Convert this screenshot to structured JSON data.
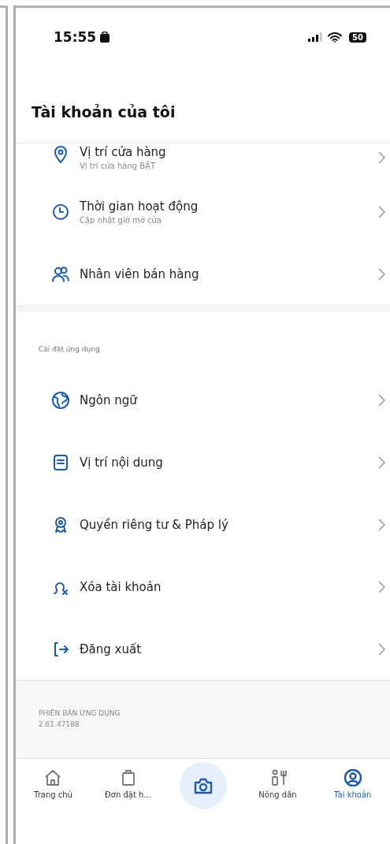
{
  "status_bar": {
    "time": "15:55",
    "battery": "50"
  },
  "header": {
    "title": "Tài khoản của tôi"
  },
  "groups": [
    {
      "items": [
        {
          "title": "Vị trí cửa hàng",
          "subtitle": "Vị trí cửa hàng BẬT"
        },
        {
          "title": "Thời gian hoạt động",
          "subtitle": "Cập nhật giờ mở cửa"
        },
        {
          "title": "Nhân viên bán hàng"
        }
      ]
    },
    {
      "section": "Cài đặt ứng dụng",
      "items": [
        {
          "title": "Ngôn ngữ"
        },
        {
          "title": "Vị trí nội dung"
        },
        {
          "title": "Quyền riêng tư & Pháp lý"
        },
        {
          "title": "Xóa tài khoản"
        },
        {
          "title": "Đăng xuất"
        }
      ]
    }
  ],
  "version": {
    "label": "PHIÊN BẢN ỨNG DỤNG",
    "value": "2.61.47188"
  },
  "tabs": [
    {
      "label": "Trang chủ",
      "selected": false
    },
    {
      "label": "Đơn đặt h...",
      "selected": false
    },
    {
      "label": "Nông dân",
      "selected": false
    },
    {
      "label": "Tài khoản",
      "selected": true
    }
  ]
}
